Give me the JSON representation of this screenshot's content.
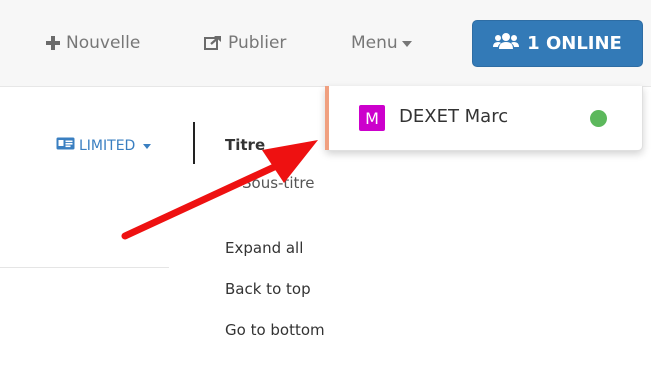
{
  "topbar": {
    "new_label": "Nouvelle",
    "publish_label": "Publier",
    "menu_label": "Menu",
    "online_label": "1 ONLINE"
  },
  "online_dropdown": {
    "users": [
      {
        "initial": "M",
        "name": "DEXET Marc",
        "avatar_color": "#cc00cc",
        "status_color": "#5cb85c"
      }
    ]
  },
  "document": {
    "access_label": "LIMITED",
    "toc": {
      "title": "Titre",
      "subtitle": "Sous-titre",
      "links": [
        "Expand all",
        "Back to top",
        "Go to bottom"
      ]
    }
  },
  "colors": {
    "accent": "#337ab7",
    "annotation_arrow": "#ee1111"
  }
}
